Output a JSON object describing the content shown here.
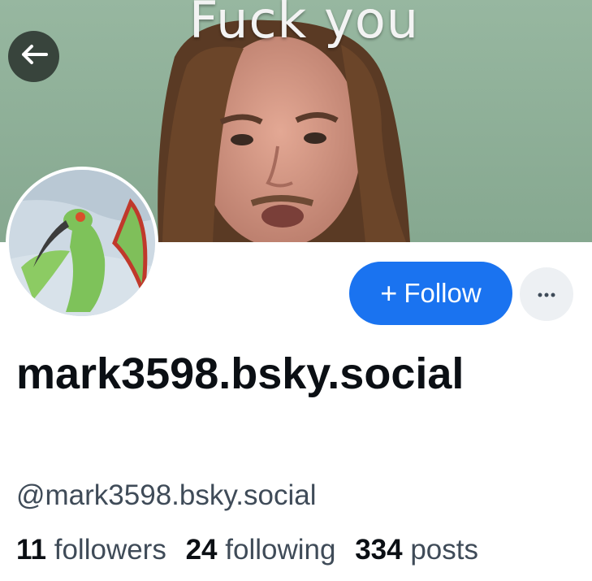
{
  "banner": {
    "caption": "Fuck you"
  },
  "profile": {
    "display_name": "mark3598.bsky.social",
    "handle": "@mark3598.bsky.social"
  },
  "actions": {
    "follow_plus": "+",
    "follow_label": "Follow",
    "more_label": "···"
  },
  "stats": {
    "followers_count": "11",
    "followers_label": "followers",
    "following_count": "24",
    "following_label": "following",
    "posts_count": "334",
    "posts_label": "posts"
  },
  "colors": {
    "follow_button": "#1a73f0",
    "banner_background": "#8fb39a"
  },
  "icons": {
    "back": "arrow-left-icon",
    "more": "ellipsis-icon"
  }
}
